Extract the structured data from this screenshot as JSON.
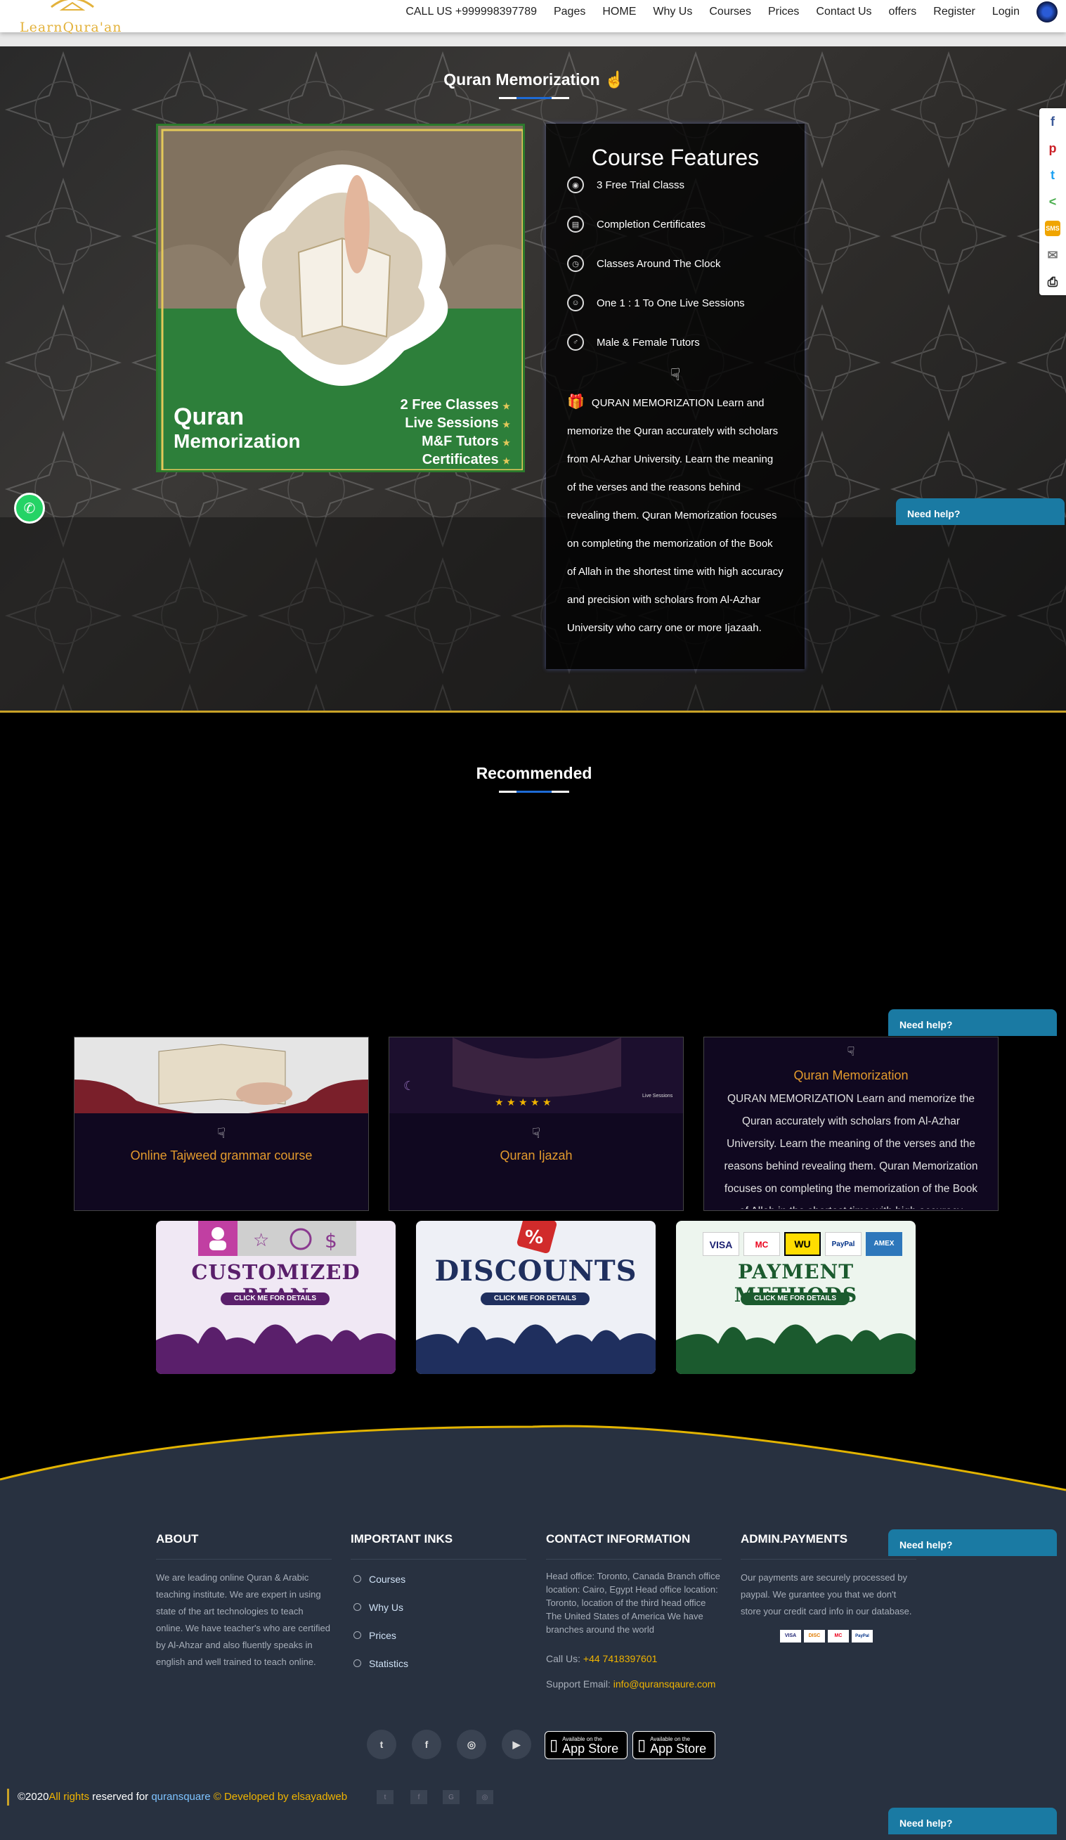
{
  "nav": {
    "logo_text": "LearnQura'an",
    "call": "CALL US +999998397789",
    "items": [
      "Pages",
      "HOME",
      "Why Us",
      "Courses",
      "Prices",
      "Contact Us",
      "offers",
      "Register",
      "Login"
    ]
  },
  "hero": {
    "title": "Quran Memorization",
    "image": {
      "title_line1": "Quran",
      "title_line2": "Memorization",
      "bullets": [
        "2 Free Classes",
        "Live Sessions",
        "M&F Tutors",
        "Certificates"
      ]
    },
    "features_title": "Course Features",
    "features": [
      {
        "icon": "trial-icon",
        "label": "3 Free Trial Classs"
      },
      {
        "icon": "certificate-icon",
        "label": "Completion Certificates"
      },
      {
        "icon": "clock-icon",
        "label": "Classes Around The Clock"
      },
      {
        "icon": "tutor-icon",
        "label": "One 1 : 1 To One Live Sessions"
      },
      {
        "icon": "gender-icon",
        "label": "Male & Female Tutors"
      }
    ],
    "description": "QURAN MEMORIZATION Learn and memorize the Quran accurately with scholars from Al-Azhar University. Learn the meaning of the verses and the reasons behind revealing them. Quran Memorization focuses on completing the memorization of the Book of Allah in the shortest time with high accuracy and precision with scholars from Al-Azhar University who carry one or more Ijazaah."
  },
  "share": [
    "f",
    "p",
    "t",
    "<",
    "SMS",
    "✉",
    "⎙"
  ],
  "help_label": "Need help?",
  "recommended": {
    "title": "Recommended",
    "cards": [
      {
        "title": "Online Tajweed grammar course"
      },
      {
        "title": "Quran Ijazah",
        "img_text": "Live Sessions"
      },
      {
        "title": "Quran Memorization",
        "desc": "QURAN MEMORIZATION Learn and memorize the Quran accurately with scholars from Al-Azhar University. Learn the meaning of the verses and the reasons behind revealing them. Quran Memorization focuses on completing the memorization of the Book of Allah in the shortest time with high accuracy"
      }
    ]
  },
  "promos": [
    {
      "title": "CUSTOMIZED PLAN",
      "button": "CLICK ME FOR DETAILS",
      "color": "#5a1f6b",
      "bg": "#f0e8f4"
    },
    {
      "title": "DISCOUNTS",
      "button": "CLICK ME FOR DETAILS",
      "color": "#1f2f5e",
      "bg": "#eef0f6"
    },
    {
      "title": "PAYMENT METHODS",
      "button": "CLICK ME FOR DETAILS",
      "color": "#1b5a2e",
      "bg": "#edf5ee",
      "cards": [
        "VISA",
        "MC",
        "WU",
        "PayPal",
        "AMEX"
      ]
    }
  ],
  "footer": {
    "about_title": "ABOUT",
    "about_text": "We are leading online Quran & Arabic teaching institute. We are expert in using state of the art technologies to teach online. We have teacher's who are certified by Al-Ahzar and also fluently speaks in english and well trained to teach online.",
    "links_title": "IMPORTANT INKS",
    "links": [
      "Courses",
      "Why Us",
      "Prices",
      "Statistics"
    ],
    "contact_title": "CONTACT INFORMATION",
    "contact_text": "Head office: Toronto, Canada Branch office location: Cairo, Egypt Head office location: Toronto, location of the third head office The United States of America We have branches around the world",
    "call_label": "Call Us:",
    "call_value": "+44 7418397601",
    "email_label": "Support Email:",
    "email_value": "info@quransqaure.com",
    "payments_title": "ADMIN.PAYMENTS",
    "payments_text": "Our payments are securely processed by paypal. We gurantee you that we don't store your credit card info in our database.",
    "payment_badges": [
      "VISA",
      "DISC",
      "MC",
      "PayPal"
    ],
    "social": [
      "t",
      "f",
      "◎",
      "▶"
    ],
    "store_small": "Available on the",
    "store_big": "App Store",
    "copy_year": "©2020",
    "copy_rights": "All rights",
    "copy_reserved": " reserved for ",
    "copy_site": "quransquare",
    "copy_dev": " © Developed by elsayadweb",
    "mini_social": [
      "t",
      "f",
      "G",
      "◎"
    ]
  }
}
